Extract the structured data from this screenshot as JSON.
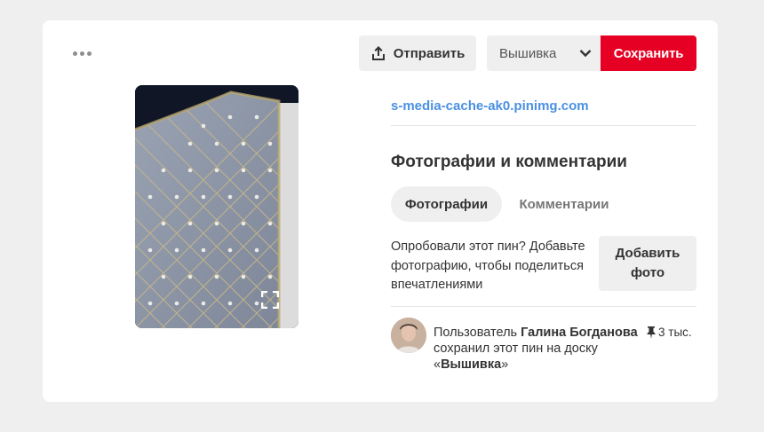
{
  "toolbar": {
    "more_icon": "more-dots-icon",
    "send_label": "Отправить",
    "send_icon": "share-upload-icon",
    "board_selected": "Вышивка",
    "board_chevron_icon": "chevron-down-icon",
    "save_label": "Сохранить",
    "save_color": "#e60023"
  },
  "pin": {
    "expand_icon": "expand-icon"
  },
  "details": {
    "source": "s-media-cache-ak0.pinimg.com",
    "source_color": "#4a90e2",
    "section_title": "Фотографии и комментарии",
    "tabs": [
      {
        "label": "Фотографии",
        "active": true
      },
      {
        "label": "Комментарии",
        "active": false
      }
    ],
    "prompt": "Опробовали этот пин? Добавьте фотографию, чтобы поделиться впечатлениями",
    "add_photo_label": "Добавить фото"
  },
  "activity": {
    "prefix": "Пользователь ",
    "user": "Галина Богданова",
    "middle": " сохранил этот пин на доску «",
    "board": "Вышивка",
    "suffix": "»",
    "save_count": "3 тыс.",
    "pin_icon": "pushpin-icon"
  }
}
